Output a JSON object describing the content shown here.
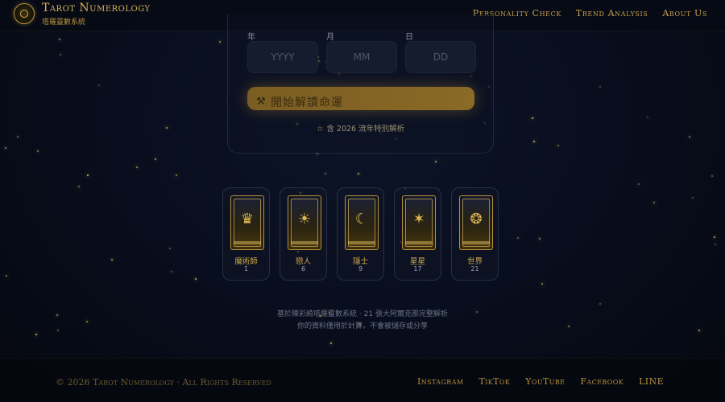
{
  "header": {
    "title": "Tarot Numerology",
    "subtitle": "塔羅靈數系統",
    "nav": [
      "Personality Check",
      "Trend Analysis",
      "About Us"
    ]
  },
  "form": {
    "year_label": "年",
    "month_label": "月",
    "day_label": "日",
    "year_placeholder": "YYYY",
    "month_placeholder": "MM",
    "day_placeholder": "DD",
    "submit_icon": "magic-wand-icon",
    "submit_label": "開始解讀命運",
    "note_icon": "star-outline-icon",
    "note": "含 2026 流年特別解析"
  },
  "cards": [
    {
      "name": "魔術師",
      "number": "1"
    },
    {
      "name": "戀人",
      "number": "6"
    },
    {
      "name": "隱士",
      "number": "9"
    },
    {
      "name": "星星",
      "number": "17"
    },
    {
      "name": "世界",
      "number": "21"
    }
  ],
  "info": {
    "line1": "基於陳彩綺塔羅靈數系統 · 21 張大阿爾克那完整解析",
    "line2": "你的資料僅用於計算，不會被儲存或分享"
  },
  "footer": {
    "copyright": "© 2026 Tarot Numerology · All Rights Reserved",
    "social": [
      "Instagram",
      "TikTok",
      "YouTube",
      "Facebook",
      "LINE"
    ]
  },
  "colors": {
    "accent": "#c9a24a",
    "background": "#080d1c",
    "button": "#7a5d22"
  }
}
